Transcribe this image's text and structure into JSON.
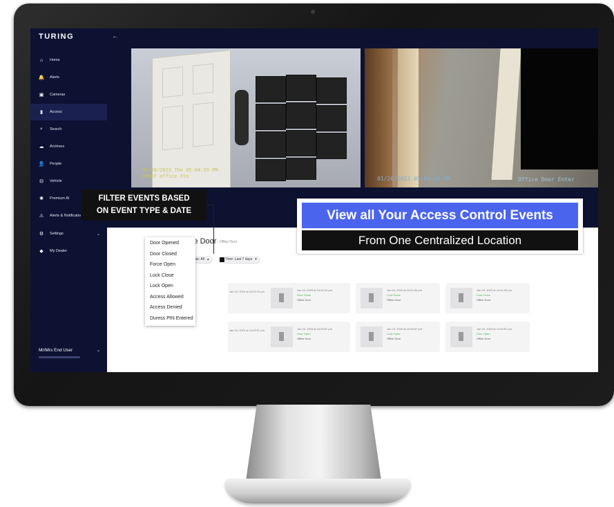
{
  "app": {
    "brand": "TURING",
    "back_icon": "arrow-left-icon"
  },
  "sidebar": {
    "items": [
      {
        "label": "Home",
        "icon": "home-icon",
        "glyph": "⌂"
      },
      {
        "label": "Alerts",
        "icon": "bell-icon",
        "glyph": "🔔"
      },
      {
        "label": "Cameras",
        "icon": "camera-icon",
        "glyph": "▣"
      },
      {
        "label": "Access",
        "icon": "door-icon",
        "glyph": "▮"
      },
      {
        "label": "Search",
        "icon": "search-icon",
        "glyph": "⌕"
      },
      {
        "label": "Archives",
        "icon": "cloud-icon",
        "glyph": "☁"
      },
      {
        "label": "People",
        "icon": "person-icon",
        "glyph": "👤"
      },
      {
        "label": "Vehicle",
        "icon": "car-icon",
        "glyph": "⊟"
      },
      {
        "label": "Premium AI",
        "icon": "ai-icon",
        "glyph": "✺"
      },
      {
        "label": "Alerts & Notificatio",
        "icon": "person-alert-icon",
        "glyph": "⚠"
      },
      {
        "label": "Settings",
        "icon": "gear-icon",
        "glyph": "⚙"
      },
      {
        "label": "My Dealer",
        "icon": "handshake-icon",
        "glyph": "◆"
      }
    ],
    "active": "Access",
    "user_name": "Mr/Mrs End User"
  },
  "cameras": [
    {
      "timestamp": "01/26/2023 Thu 05:04:59 PM",
      "name": "OWNIF office Fte"
    },
    {
      "timestamp": "01/26/2023 05:04:58 PM",
      "name": "Office Door Enter"
    }
  ],
  "main": {
    "title": "Office Door",
    "breadcrumb": "Office Door",
    "event_type_chip": "Event Type: All",
    "time_chip": "Time: Last 7 days",
    "event_options": [
      "Door Opened",
      "Door Closed",
      "Force Open",
      "Lock Close",
      "Lock Open",
      "Access Allowed",
      "Access Denied",
      "Duress PIN Entered"
    ],
    "cards": [
      {
        "date": "Jan 24, 2023 at 14:01:01 pm",
        "event": "",
        "location": ""
      },
      {
        "date": "Jan 24, 2023 at 14:01:01 pm",
        "event": "Door Close",
        "location": "Office Door"
      },
      {
        "date": "Jan 24, 2023 at 14:01:00 pm",
        "event": "Lock Close",
        "location": "Office Door"
      },
      {
        "date": "Jan 24, 2023 at 14:01:00 pm",
        "event": "Lock Close",
        "location": "Office Door"
      },
      {
        "date": "Jan 24, 2023 at 14:00:57 pm",
        "event": "",
        "location": ""
      },
      {
        "date": "Jan 24, 2023 at 14:00:57 pm",
        "event": "Door Open",
        "location": "Office Door"
      },
      {
        "date": "Jan 24, 2023 at 14:00:57 pm",
        "event": "Lock Open",
        "location": "Office Door"
      },
      {
        "date": "Jan 24, 2023 at 14:00:57 pm",
        "event": "Door Open",
        "location": "Office Door"
      }
    ]
  },
  "overlay": {
    "filter_line1": "FILTER EVENTS BASED",
    "filter_line2": "ON EVENT TYPE & DATE",
    "promo_title": "View all Your Access Control Events",
    "promo_subtitle": "From One Centralized Location"
  },
  "colors": {
    "sidebar": "#0d1233",
    "accent": "#4a64ee",
    "event_green": "#4caf50"
  }
}
